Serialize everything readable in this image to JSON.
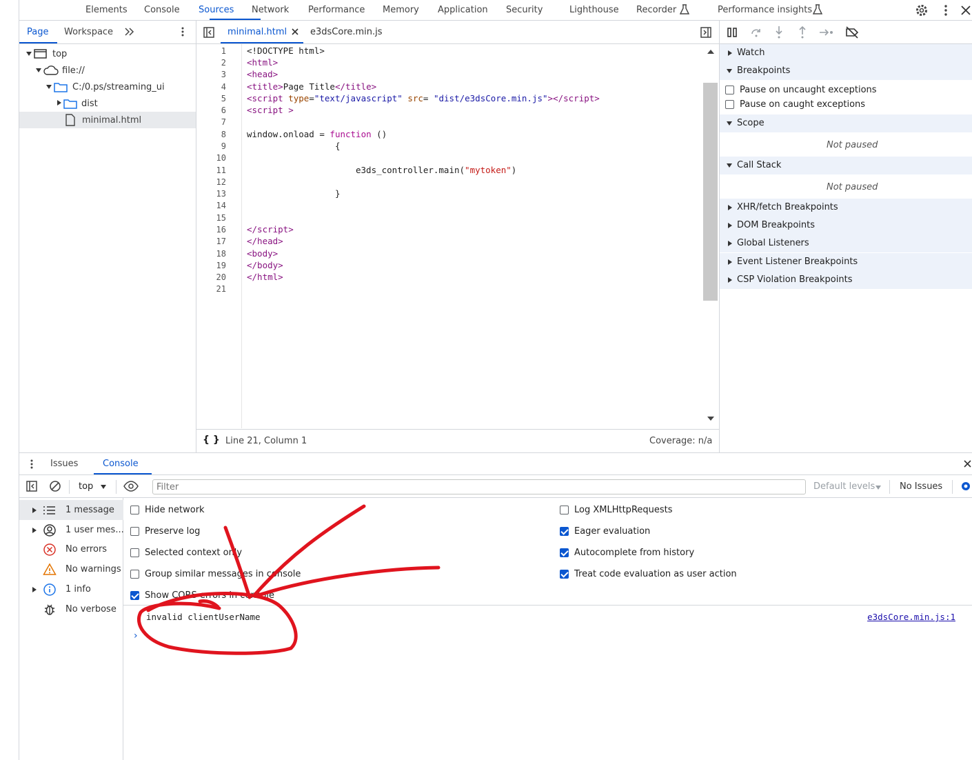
{
  "topbar": {
    "tabs": [
      "Elements",
      "Console",
      "Sources",
      "Network",
      "Performance",
      "Memory",
      "Application",
      "Security",
      "Lighthouse",
      "Recorder",
      "Performance insights"
    ],
    "active_tab": "Sources"
  },
  "navigator": {
    "tabs": [
      "Page",
      "Workspace"
    ],
    "tree": [
      "top",
      "file://",
      "C:/0.ps/streaming_ui",
      "dist",
      "minimal.html"
    ]
  },
  "editor": {
    "tabs": [
      "minimal.html",
      "e3dsCore.min.js"
    ],
    "line_numbers": [
      "1",
      "2",
      "3",
      "4",
      "5",
      "6",
      "7",
      "8",
      "9",
      "10",
      "11",
      "12",
      "13",
      "14",
      "15",
      "16",
      "17",
      "18",
      "19",
      "20",
      "21"
    ],
    "status_position": "Line 21, Column 1",
    "coverage": "Coverage: n/a",
    "code": {
      "l1": "<!DOCTYPE html>",
      "l2_open": "<",
      "l2_tag": "html",
      "l2_close": ">",
      "l3_tag": "head",
      "l4_tag": "title",
      "l4_text": "Page Title",
      "l4_endtag": "/title",
      "l5_tag": "script",
      "l5_attr1": "type",
      "l5_val1": "\"text/javascript\"",
      "l5_attr2": "src",
      "l5_val2": "\"dist/e3dsCore.min.js\"",
      "l5_endtag": "/script",
      "l6_tag": "script",
      "l8_pre": "window.onload = ",
      "l8_kw": "function",
      "l8_post": " ()",
      "l9": "{",
      "l11_pre": "e3ds_controller.main(",
      "l11_str": "\"mytoken\"",
      "l11_post": ")",
      "l13": "}",
      "l16_tag": "/script",
      "l17_tag": "/head",
      "l18_tag": "body",
      "l19_tag": "/body",
      "l20_tag": "/html"
    }
  },
  "debugger": {
    "watch": "Watch",
    "breakpoints": "Breakpoints",
    "pause_uncaught": "Pause on uncaught exceptions",
    "pause_caught": "Pause on caught exceptions",
    "scope": "Scope",
    "not_paused": "Not paused",
    "call_stack": "Call Stack",
    "xhr": "XHR/fetch Breakpoints",
    "dom": "DOM Breakpoints",
    "global": "Global Listeners",
    "event": "Event Listener Breakpoints",
    "csp": "CSP Violation Breakpoints"
  },
  "drawer": {
    "tabs": [
      "Issues",
      "Console"
    ],
    "active_tab": "Console",
    "context": "top",
    "filter_placeholder": "Filter",
    "levels": "Default levels",
    "issues": "No Issues",
    "sidebar": [
      "1 message",
      "1 user mes...",
      "No errors",
      "No warnings",
      "1 info",
      "No verbose"
    ],
    "options_left": [
      "Hide network",
      "Preserve log",
      "Selected context only",
      "Group similar messages in console",
      "Show CORS errors in console"
    ],
    "options_left_checked": [
      false,
      false,
      false,
      false,
      true
    ],
    "options_right": [
      "Log XMLHttpRequests",
      "Eager evaluation",
      "Autocomplete from history",
      "Treat code evaluation as user action"
    ],
    "options_right_checked": [
      false,
      true,
      true,
      true
    ],
    "message": "invalid clientUserName",
    "message_source": "e3dsCore.min.js:1"
  },
  "colors": {
    "accent": "#0b57d0",
    "annotation": "#e0141e"
  }
}
